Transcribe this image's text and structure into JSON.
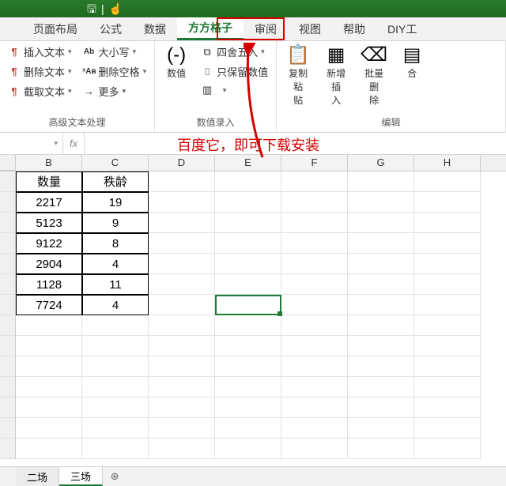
{
  "qat": {
    "save": "🖫",
    "touch": "☝",
    "sep": "|"
  },
  "tabs": {
    "layout": "页面布局",
    "formulas": "公式",
    "data": "数据",
    "ffgz": "方方格子",
    "review": "审阅",
    "view": "视图",
    "help": "帮助",
    "diy": "DIY工"
  },
  "ribbon": {
    "group1": {
      "insert_text": "插入文本",
      "delete_text": "删除文本",
      "extract_text": "截取文本",
      "case": "大小写",
      "del_space": "删除空格",
      "more": "更多",
      "label": "高级文本处理"
    },
    "group2": {
      "value": "数值",
      "round": "四舍五入",
      "keep_num": "只保留数值",
      "label": "数值录入"
    },
    "group3": {
      "copy_paste": "复制粘\n贴",
      "add_insert": "新增插\n入",
      "batch_del": "批量删\n除",
      "merge": "合",
      "label": "编辑"
    }
  },
  "annotation": "百度它，即可下载安装",
  "cols": [
    "B",
    "C",
    "D",
    "E",
    "F",
    "G",
    "H"
  ],
  "table": {
    "headers": [
      "数量",
      "秩龄"
    ],
    "rows": [
      [
        "2217",
        "19"
      ],
      [
        "5123",
        "9"
      ],
      [
        "9122",
        "8"
      ],
      [
        "2904",
        "4"
      ],
      [
        "1128",
        "11"
      ],
      [
        "7724",
        "4"
      ]
    ]
  },
  "sheets": {
    "s1": "二场",
    "s2": "三场"
  },
  "icons": {
    "dd": "▾",
    "plus": "⊕",
    "ab": "Ab",
    "xab": "ˣAʙ",
    "arrow": "→",
    "val": "(-)",
    "r1": "⧉",
    "r2": "⌷",
    "r3": "▥",
    "cp": "📋",
    "ins": "▦",
    "del": "⌫"
  }
}
